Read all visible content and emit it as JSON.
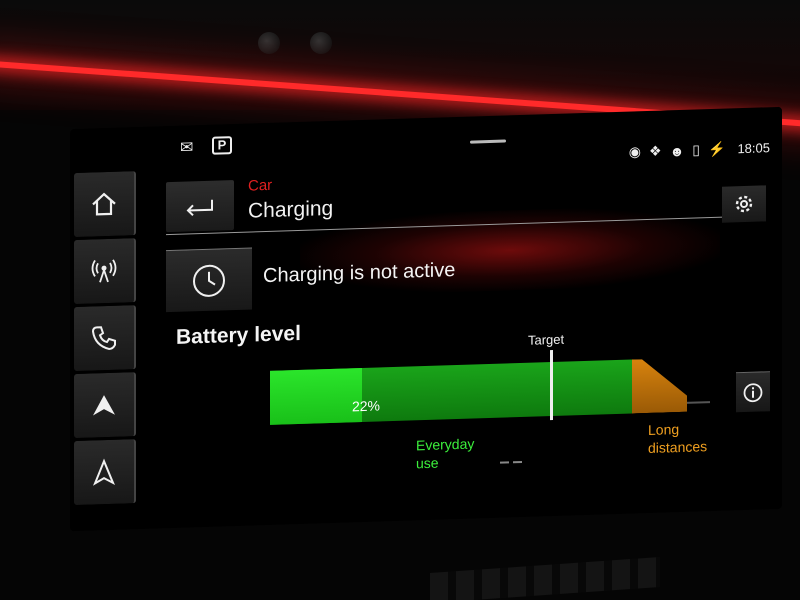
{
  "status_bar": {
    "mail_icon": "mail-icon",
    "parking_label": "P",
    "icons": [
      "wireless-icon",
      "bluetooth-icon",
      "user-icon",
      "phone-battery-icon",
      "charging-station-icon"
    ],
    "time": "18:05"
  },
  "left_nav": [
    {
      "name": "home",
      "icon": "home-icon"
    },
    {
      "name": "radio",
      "icon": "radio-icon"
    },
    {
      "name": "phone",
      "icon": "phone-icon"
    },
    {
      "name": "carplay",
      "icon": "carplay-icon"
    },
    {
      "name": "navigation",
      "icon": "navigation-icon"
    }
  ],
  "header": {
    "breadcrumb": "Car",
    "title": "Charging"
  },
  "charging": {
    "status": "Charging is not active"
  },
  "battery": {
    "heading": "Battery level",
    "level_percent": 22,
    "level_label": "22%",
    "target_label": "Target",
    "everyday_label": "Everyday use",
    "long_label": "Long distances"
  },
  "colors": {
    "accent_red": "#e02020",
    "battery_green": "#19c019",
    "long_orange": "#f0a020"
  }
}
